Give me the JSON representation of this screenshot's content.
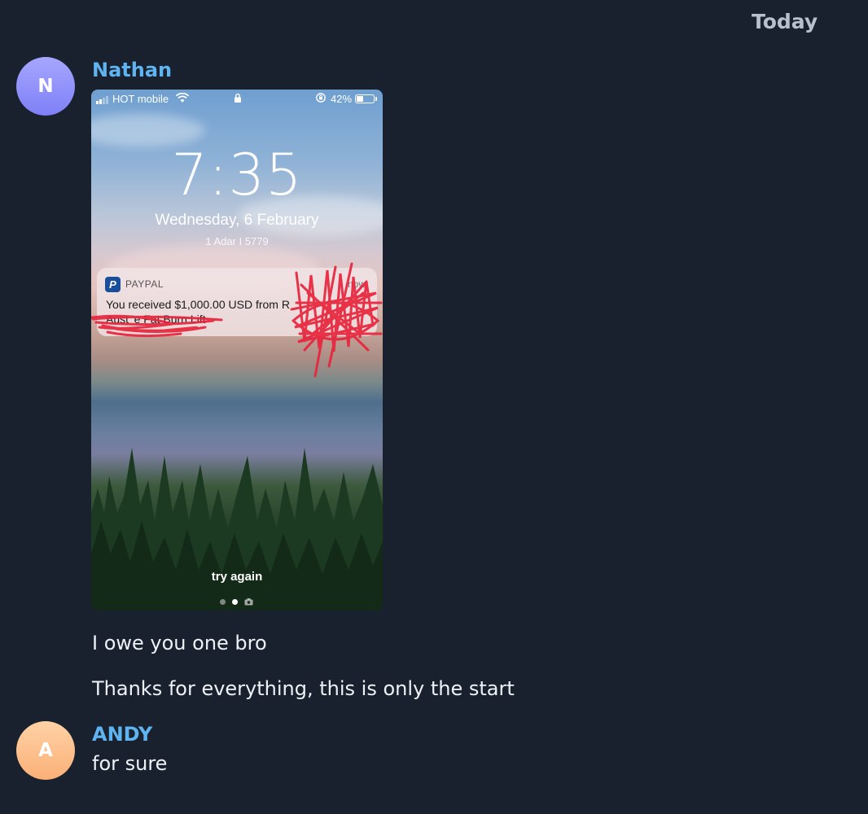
{
  "date_separator": "Today",
  "messages": [
    {
      "sender": "Nathan",
      "avatar_initial": "N",
      "avatar_color": "#8f8ffb",
      "name_color": "#5fb3f0",
      "attachment": {
        "status_bar": {
          "carrier": "HOT mobile",
          "battery_percent_label": "42%",
          "battery_level": 0.42,
          "icons": [
            "signal-icon",
            "wifi-icon",
            "lock-icon",
            "rotation-lock-icon",
            "battery-icon"
          ]
        },
        "clock": "7:35",
        "date": "Wednesday, 6 February",
        "hebrew_date": "1 Adar I 5779",
        "notification": {
          "app_name": "PAYPAL",
          "time": "now",
          "body": "You received $1,000.00 USD from",
          "body_tail": "R",
          "line2": "Aust  'e Fat Burn Lift"
        },
        "bottom_label": "try again"
      },
      "texts": [
        "I owe you one bro",
        "Thanks for everything, this is only the start"
      ]
    },
    {
      "sender": "ANDY",
      "avatar_initial": "A",
      "avatar_color": "#fcc08a",
      "name_color": "#5fb3f0",
      "texts": [
        "for sure"
      ]
    }
  ]
}
